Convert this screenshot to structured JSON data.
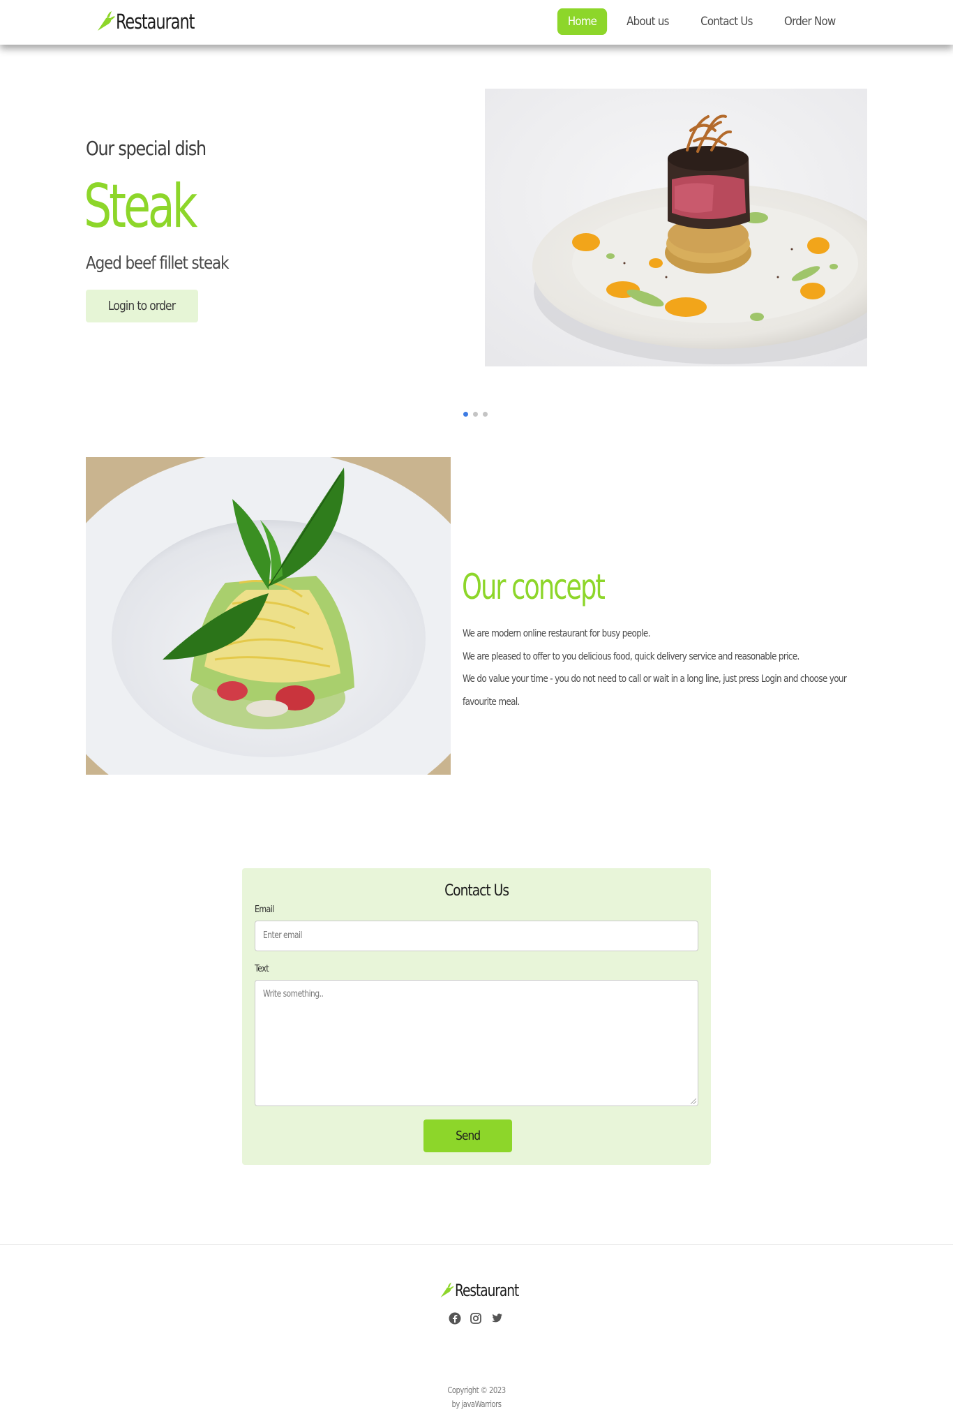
{
  "navbar": {
    "brand": "Restaurant",
    "links": [
      {
        "label": "Home",
        "active": true
      },
      {
        "label": "About us",
        "active": false
      },
      {
        "label": "Contact Us",
        "active": false
      },
      {
        "label": "Order Now",
        "active": false
      }
    ]
  },
  "hero": {
    "subtitle": "Our special dish",
    "title": "Steak",
    "description": "Aged beef fillet steak",
    "button": "Login to order",
    "slides": 3,
    "active_slide": 1
  },
  "concept": {
    "title": "Our concept",
    "paragraphs": [
      "We are modern online restaurant for busy people.",
      "We are pleased to offer to you delicious food, quick delivery service and reasonable price.",
      "We do value your time - you do not need to call or wait in a long line, just press Login and choose your",
      "favourite meal."
    ]
  },
  "contact": {
    "title": "Contact Us",
    "email_label": "Email",
    "email_placeholder": "Enter email",
    "text_label": "Text",
    "text_placeholder": "Write something..",
    "send": "Send"
  },
  "footer": {
    "brand": "Restaurant",
    "socials": [
      "facebook-icon",
      "instagram-icon",
      "twitter-icon"
    ],
    "copyright": "Copyright © 2023",
    "author": "by javaWarriors"
  },
  "colors": {
    "accent": "#8dd62a",
    "accent_light": "#e8f5d9",
    "dot_active": "#3d7be3"
  }
}
